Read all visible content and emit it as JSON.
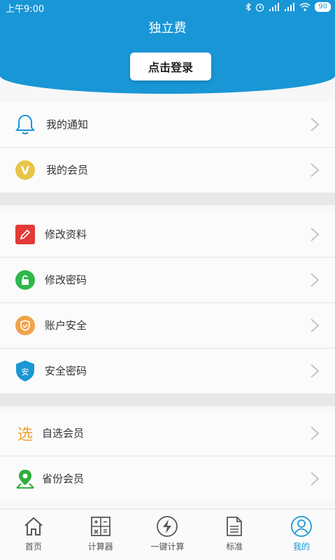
{
  "status_bar": {
    "time": "上午9:00",
    "battery": "90"
  },
  "header": {
    "title": "独立费",
    "login_label": "点击登录"
  },
  "sections": [
    {
      "items": [
        {
          "label": "我的通知",
          "icon": "bell-icon"
        },
        {
          "label": "我的会员",
          "icon": "vip-icon",
          "icon_text": "V"
        }
      ]
    },
    {
      "items": [
        {
          "label": "修改资料",
          "icon": "edit-icon"
        },
        {
          "label": "修改密码",
          "icon": "lock-icon"
        },
        {
          "label": "账户安全",
          "icon": "shield-icon"
        },
        {
          "label": "安全密码",
          "icon": "security-shield-icon",
          "icon_text": "安"
        }
      ]
    },
    {
      "items": [
        {
          "label": "自选会员",
          "icon": "select-icon",
          "icon_text": "选"
        },
        {
          "label": "省份会员",
          "icon": "location-pin-icon"
        }
      ]
    }
  ],
  "tabs": [
    {
      "label": "首页",
      "icon": "home-icon"
    },
    {
      "label": "计算器",
      "icon": "calculator-icon"
    },
    {
      "label": "一键计算",
      "icon": "lightning-icon"
    },
    {
      "label": "标准",
      "icon": "document-icon"
    },
    {
      "label": "我的",
      "icon": "user-icon",
      "active": true
    }
  ],
  "colors": {
    "accent": "#1996d6",
    "edit": "#e23a36",
    "lock": "#2db84b",
    "shield": "#f0a24a",
    "vip": "#e9c44a",
    "select": "#f0a030",
    "location": "#2fae3c"
  }
}
